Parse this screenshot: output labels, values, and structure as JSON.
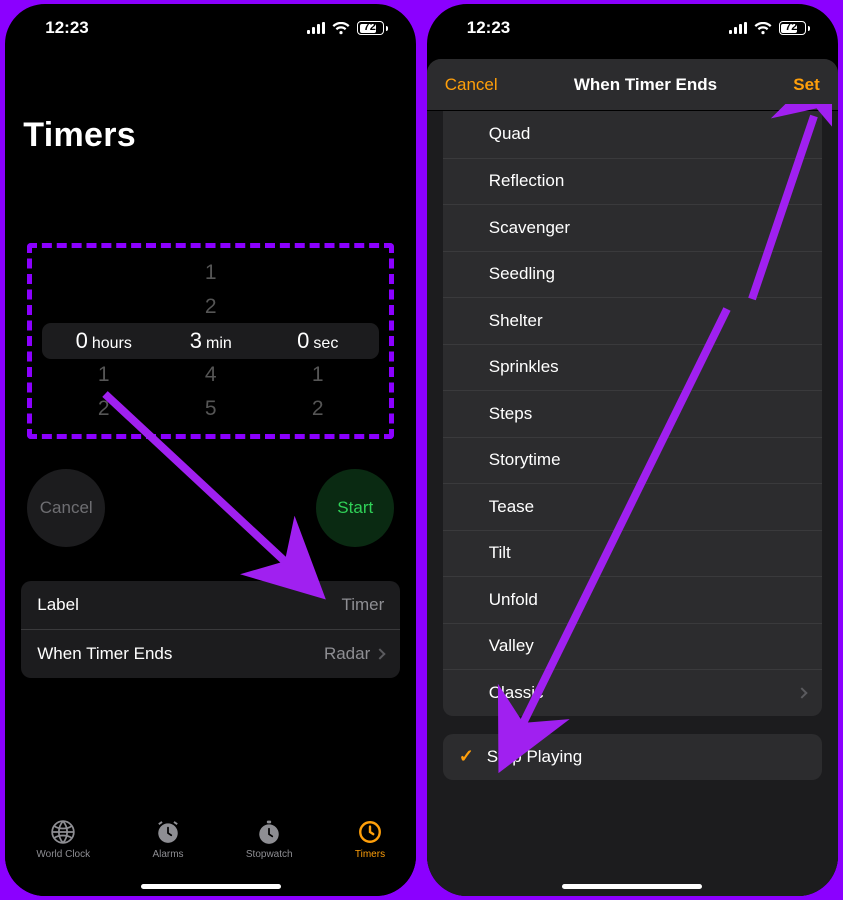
{
  "status": {
    "time": "12:23",
    "battery_pct": "72",
    "battery_fill_pct": 72
  },
  "screen1": {
    "title": "Timers",
    "picker": {
      "hours": {
        "above1": "",
        "above2": "",
        "value": "0",
        "unit": "hours",
        "below1": "1",
        "below2": "2"
      },
      "minutes": {
        "above1": "1",
        "above2": "2",
        "value": "3",
        "unit": "min",
        "below1": "4",
        "below2": "5"
      },
      "seconds": {
        "above1": "",
        "above2": "",
        "value": "0",
        "unit": "sec",
        "below1": "1",
        "below2": "2"
      }
    },
    "buttons": {
      "cancel": "Cancel",
      "start": "Start"
    },
    "settings": {
      "label_title": "Label",
      "label_value": "Timer",
      "ends_title": "When Timer Ends",
      "ends_value": "Radar"
    },
    "tabs": {
      "world": "World Clock",
      "alarms": "Alarms",
      "stopwatch": "Stopwatch",
      "timers": "Timers"
    }
  },
  "screen2": {
    "header": {
      "cancel": "Cancel",
      "title": "When Timer Ends",
      "set": "Set"
    },
    "sounds": [
      "Quad",
      "Reflection",
      "Scavenger",
      "Seedling",
      "Shelter",
      "Sprinkles",
      "Steps",
      "Storytime",
      "Tease",
      "Tilt",
      "Unfold",
      "Valley",
      "Classic"
    ],
    "stop_playing": "Stop Playing"
  }
}
